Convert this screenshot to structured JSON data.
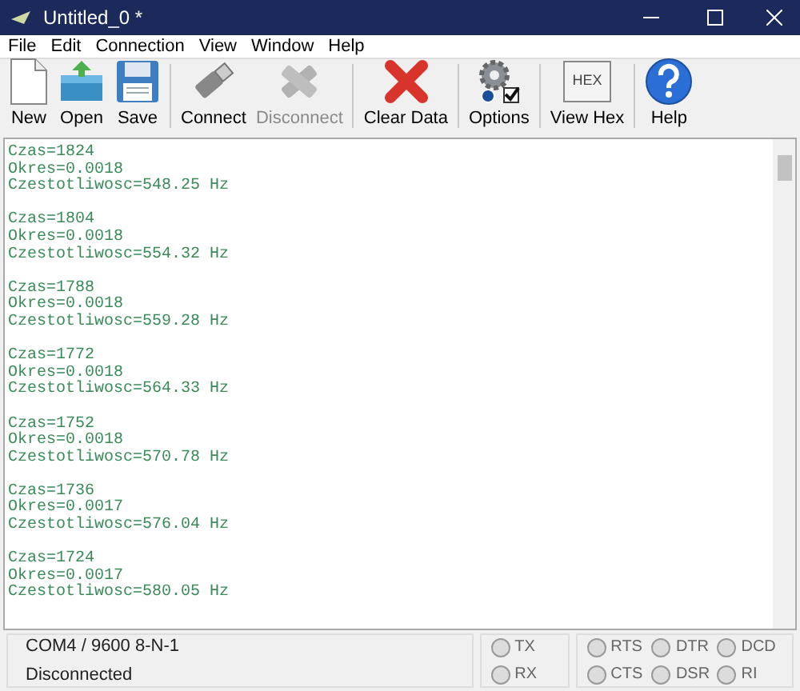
{
  "window": {
    "title": "Untitled_0 *"
  },
  "menu": [
    "File",
    "Edit",
    "Connection",
    "View",
    "Window",
    "Help"
  ],
  "toolbar_groups": [
    [
      {
        "label": "New",
        "kind": "new",
        "disabled": false
      },
      {
        "label": "Open",
        "kind": "open",
        "disabled": false
      },
      {
        "label": "Save",
        "kind": "save",
        "disabled": false
      }
    ],
    [
      {
        "label": "Connect",
        "kind": "connect",
        "disabled": false
      },
      {
        "label": "Disconnect",
        "kind": "disconnect",
        "disabled": true
      }
    ],
    [
      {
        "label": "Clear Data",
        "kind": "clear",
        "disabled": false
      }
    ],
    [
      {
        "label": "Options",
        "kind": "options",
        "disabled": false
      }
    ],
    [
      {
        "label": "View Hex",
        "kind": "hex",
        "disabled": false
      }
    ],
    [
      {
        "label": "Help",
        "kind": "help",
        "disabled": false
      }
    ]
  ],
  "hex_icon_text": "HEX",
  "terminal_blocks": [
    [
      "Czas=1824",
      "Okres=0.0018",
      "Czestotliwosc=548.25 Hz"
    ],
    [
      "Czas=1804",
      "Okres=0.0018",
      "Czestotliwosc=554.32 Hz"
    ],
    [
      "Czas=1788",
      "Okres=0.0018",
      "Czestotliwosc=559.28 Hz"
    ],
    [
      "Czas=1772",
      "Okres=0.0018",
      "Czestotliwosc=564.33 Hz"
    ],
    [
      "Czas=1752",
      "Okres=0.0018",
      "Czestotliwosc=570.78 Hz"
    ],
    [
      "Czas=1736",
      "Okres=0.0017",
      "Czestotliwosc=576.04 Hz"
    ],
    [
      "Czas=1724",
      "Okres=0.0017",
      "Czestotliwosc=580.05 Hz"
    ]
  ],
  "status_bar": {
    "port": "COM4 / 9600 8-N-1",
    "state": "Disconnected",
    "data_leds": [
      {
        "label": "TX",
        "on": false
      },
      {
        "label": "RX",
        "on": false
      }
    ],
    "line_leds": [
      {
        "label": "RTS",
        "on": false
      },
      {
        "label": "DTR",
        "on": false
      },
      {
        "label": "DCD",
        "on": false
      },
      {
        "label": "CTS",
        "on": false
      },
      {
        "label": "DSR",
        "on": false
      },
      {
        "label": "RI",
        "on": false
      }
    ]
  }
}
